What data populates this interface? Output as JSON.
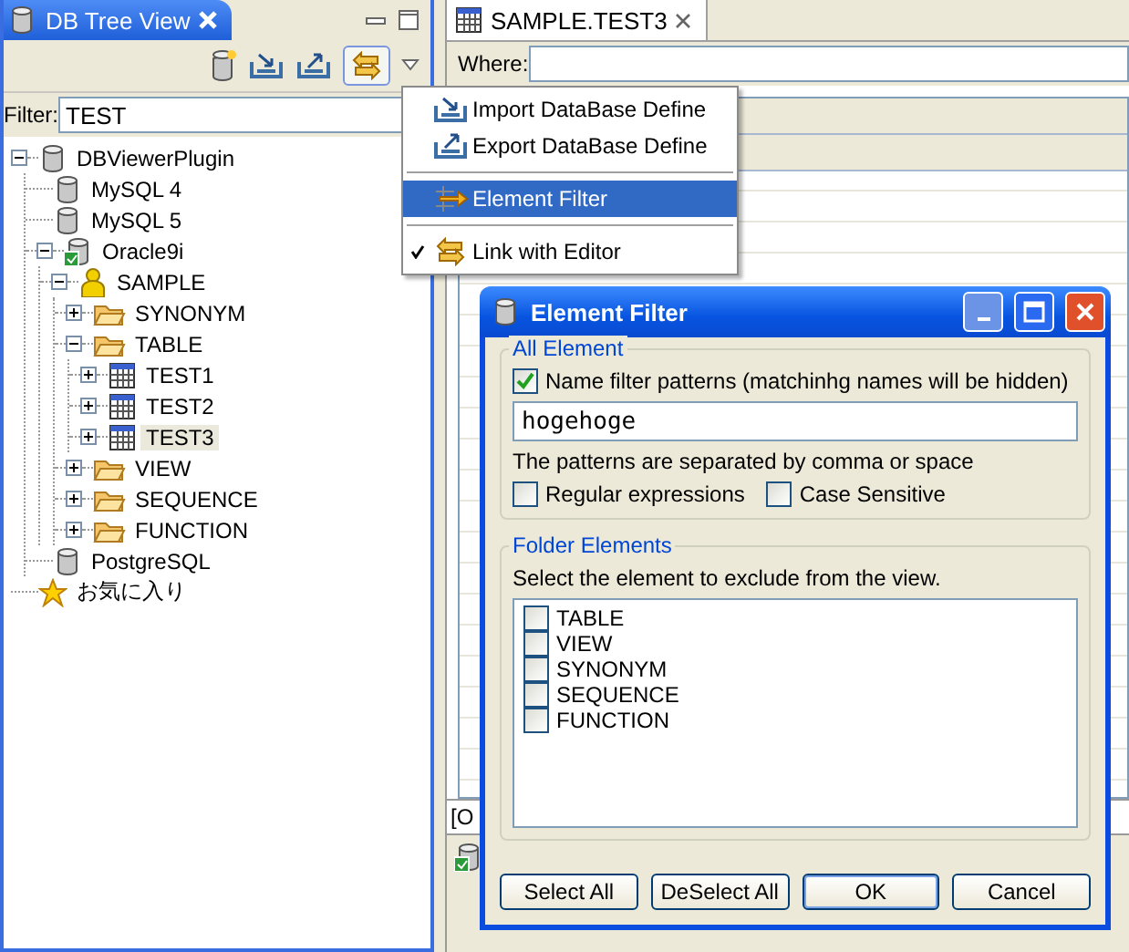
{
  "tree_view": {
    "title": "DB Tree View",
    "filter": {
      "label": "Filter:",
      "value": "TEST"
    },
    "tree": [
      {
        "label": "DBViewerPlugin",
        "kind": "database",
        "expanded": true,
        "selected": false,
        "children": [
          {
            "label": "MySQL 4",
            "kind": "database",
            "selected": false
          },
          {
            "label": "MySQL 5",
            "kind": "database",
            "selected": false
          },
          {
            "label": "Oracle9i",
            "kind": "connection",
            "expanded": true,
            "selected": false,
            "children": [
              {
                "label": "SAMPLE",
                "kind": "schema",
                "expanded": true,
                "selected": false,
                "children": [
                  {
                    "label": "SYNONYM",
                    "kind": "folder",
                    "expanded": false,
                    "selected": false
                  },
                  {
                    "label": "TABLE",
                    "kind": "folder",
                    "expanded": true,
                    "selected": false,
                    "children": [
                      {
                        "label": "TEST1",
                        "kind": "table",
                        "expanded": false,
                        "selected": false
                      },
                      {
                        "label": "TEST2",
                        "kind": "table",
                        "expanded": false,
                        "selected": false
                      },
                      {
                        "label": "TEST3",
                        "kind": "table",
                        "expanded": false,
                        "selected": true
                      }
                    ]
                  },
                  {
                    "label": "VIEW",
                    "kind": "folder",
                    "expanded": false,
                    "selected": false
                  },
                  {
                    "label": "SEQUENCE",
                    "kind": "folder",
                    "expanded": false,
                    "selected": false
                  },
                  {
                    "label": "FUNCTION",
                    "kind": "folder",
                    "expanded": false,
                    "selected": false
                  }
                ]
              }
            ]
          },
          {
            "label": "PostgreSQL",
            "kind": "database",
            "selected": false
          }
        ]
      },
      {
        "label": "お気に入り",
        "kind": "favorites",
        "selected": false
      }
    ]
  },
  "editor": {
    "tab_title": "SAMPLE.TEST3",
    "where_label": "Where:",
    "bottom_tab": "[O"
  },
  "menu": {
    "items": [
      {
        "kind": "item",
        "label": "Import DataBase Define",
        "selected": false,
        "checked": false
      },
      {
        "kind": "item",
        "label": "Export DataBase Define",
        "selected": false,
        "checked": false
      },
      {
        "kind": "separator"
      },
      {
        "kind": "item",
        "label": "Element Filter",
        "selected": true,
        "checked": false
      },
      {
        "kind": "separator"
      },
      {
        "kind": "item",
        "label": "Link with Editor",
        "selected": false,
        "checked": true
      }
    ]
  },
  "dialog": {
    "title": "Element Filter",
    "all_element": {
      "legend": "All Element",
      "name_filter": {
        "label": "Name filter patterns (matchinhg names will be hidden)",
        "checked": true
      },
      "patterns": {
        "value": "hogehoge"
      },
      "hint": "The patterns are separated by comma or space",
      "options": [
        {
          "label": "Regular expressions",
          "checked": false
        },
        {
          "label": "Case Sensitive",
          "checked": false
        }
      ]
    },
    "folder_elements": {
      "legend": "Folder Elements",
      "description": "Select the element to exclude from the view.",
      "items": [
        {
          "label": "TABLE",
          "checked": false
        },
        {
          "label": "VIEW",
          "checked": false
        },
        {
          "label": "SYNONYM",
          "checked": false
        },
        {
          "label": "SEQUENCE",
          "checked": false
        },
        {
          "label": "FUNCTION",
          "checked": false
        }
      ]
    },
    "buttons": [
      {
        "label": "Select All",
        "default": false
      },
      {
        "label": "DeSelect All",
        "default": false
      },
      {
        "label": "OK",
        "default": true
      },
      {
        "label": "Cancel",
        "default": false
      }
    ]
  }
}
